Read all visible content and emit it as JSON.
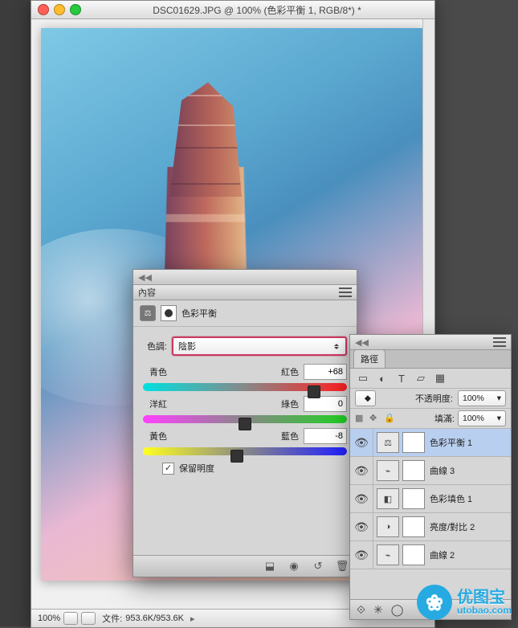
{
  "titlebar": {
    "title": "DSC01629.JPG @ 100% (色彩平衡 1, RGB/8*) *"
  },
  "status": {
    "zoom": "100%",
    "filesize_label": "文件:",
    "filesize": "953.6K/953.6K"
  },
  "properties": {
    "panel_title": "內容",
    "adj_name": "色彩平衡",
    "tone_label": "色調:",
    "tone_selected": "陰影",
    "sliders": {
      "cr_left": "青色",
      "cr_right": "紅色",
      "cr_val": "+68",
      "mg_left": "洋紅",
      "mg_right": "綠色",
      "mg_val": "0",
      "yb_left": "黃色",
      "yb_right": "藍色",
      "yb_val": "-8"
    },
    "preserve_lum": "保留明度",
    "slider_pos": {
      "cr": 84,
      "mg": 50,
      "yb": 46
    }
  },
  "layers_panel": {
    "tabs": [
      "路徑"
    ],
    "opacity_label": "不透明度:",
    "opacity_val": "100%",
    "fill_label": "填滿:",
    "fill_val": "100%",
    "layers": [
      {
        "name": "色彩平衡 1",
        "sel": true,
        "icon": "⚖"
      },
      {
        "name": "曲線 3",
        "icon": "⌁"
      },
      {
        "name": "色彩填色 1",
        "icon": "◧"
      },
      {
        "name": "亮度/對比 2",
        "icon": "◑"
      },
      {
        "name": "曲線 2",
        "icon": "⌁"
      }
    ]
  },
  "watermark": {
    "brand_cn": "优图宝",
    "brand_url": "utobao.com"
  }
}
